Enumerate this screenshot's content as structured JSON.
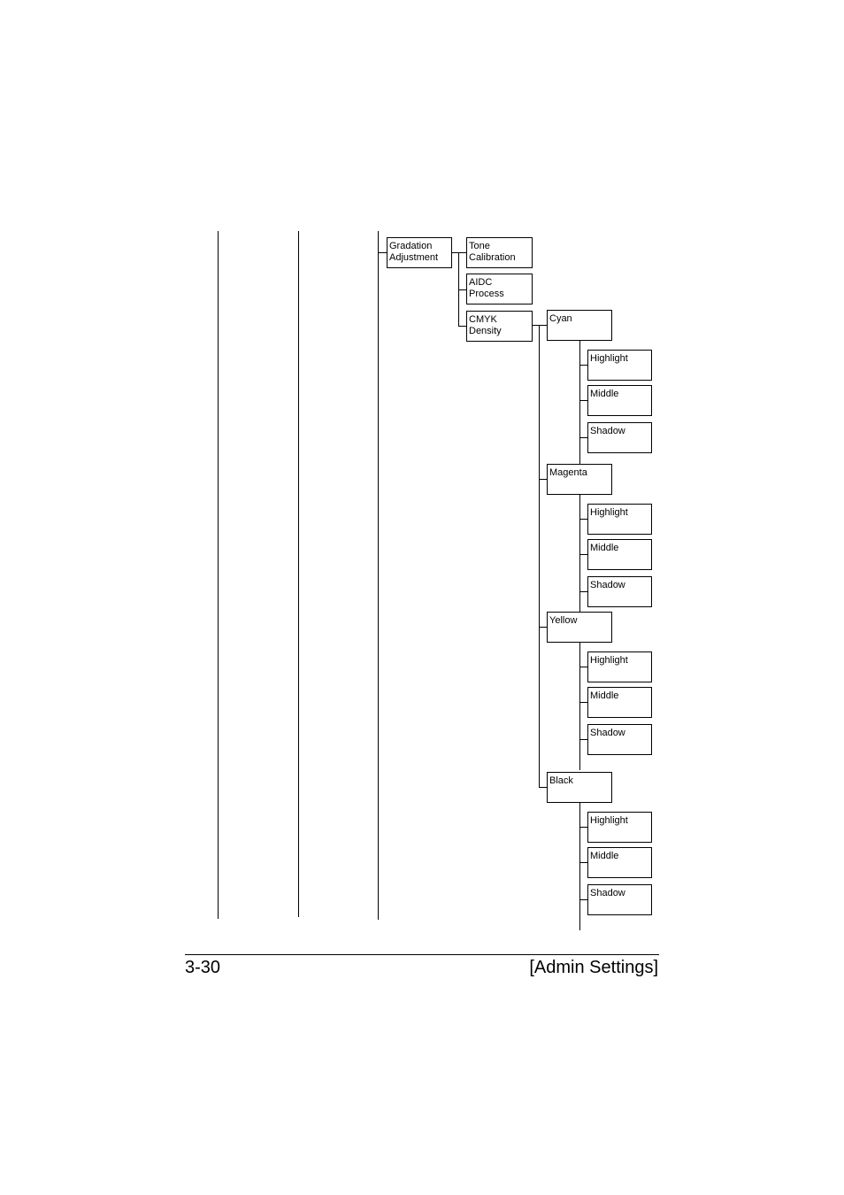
{
  "tree": {
    "root": {
      "label": "Gradation\nAdjustment"
    },
    "children": [
      {
        "label": "Tone\nCalibration"
      },
      {
        "label": "AIDC\nProcess"
      },
      {
        "label": "CMYK\nDensity"
      }
    ],
    "colors": [
      {
        "label": "Cyan",
        "levels": [
          "Highlight",
          "Middle",
          "Shadow"
        ]
      },
      {
        "label": "Magenta",
        "levels": [
          "Highlight",
          "Middle",
          "Shadow"
        ]
      },
      {
        "label": "Yellow",
        "levels": [
          "Highlight",
          "Middle",
          "Shadow"
        ]
      },
      {
        "label": "Black",
        "levels": [
          "Highlight",
          "Middle",
          "Shadow"
        ]
      }
    ]
  },
  "footer": {
    "page_number": "3-30",
    "section": "[Admin Settings]"
  }
}
